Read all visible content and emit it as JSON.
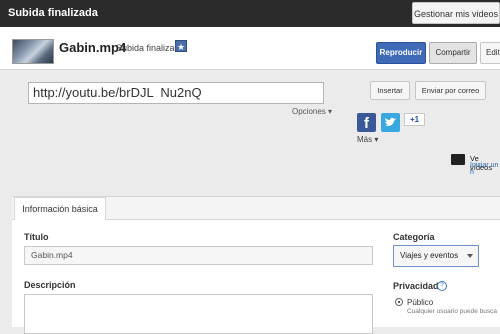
{
  "topbar": {
    "title": "Subida finalizada",
    "manage_label": "Gestionar mis videos"
  },
  "header": {
    "filename": "Gabin.mp4",
    "status": "Subida finalizada",
    "star_icon": "★",
    "play_label": "Reproducir",
    "share_label": "Compartir",
    "edit_label": "Edita"
  },
  "share": {
    "url": "http://youtu.be/brDJL  Nu2nQ",
    "options_label": "Opciones ▾",
    "insert_label": "Insertar",
    "email_label": "Enviar por correo",
    "facebook_icon": "f",
    "googleplus_label": "+1",
    "more_label": "Más ▾",
    "videos_title": "Ve vídeos",
    "videos_link": "Iniciar un h"
  },
  "form": {
    "tab_label": "Información básica",
    "title_label": "Título",
    "title_value": "Gabin.mp4",
    "description_label": "Descripción",
    "category_label": "Categoría",
    "category_value": "Viajes y eventos",
    "privacy_label": "Privacidad",
    "help_icon": "?",
    "public_label": "Público",
    "public_desc": "Cualquier usuario puede busca"
  },
  "colors": {
    "primary_button": "#3e6ab7",
    "facebook": "#3b5998",
    "twitter": "#3aa8e0"
  }
}
